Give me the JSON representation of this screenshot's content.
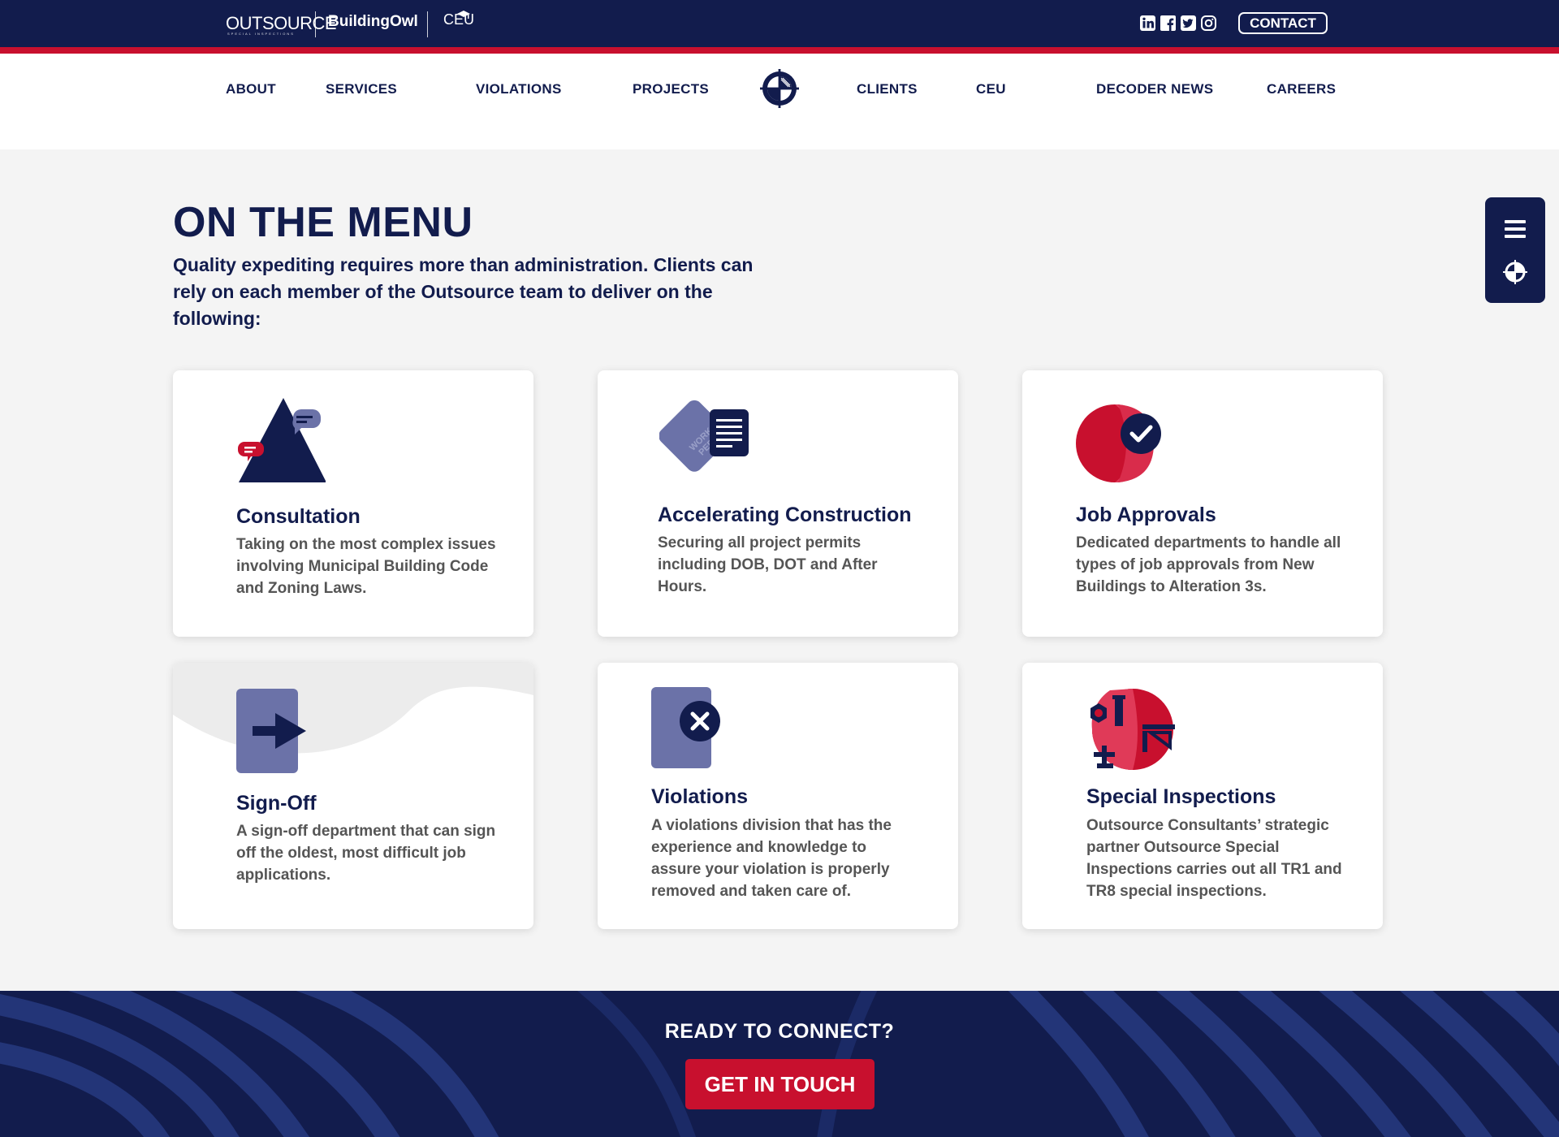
{
  "header": {
    "brand_outsource": "OUTSOURCE",
    "brand_outsource_sub": "SPECIAL INSPECTIONS",
    "brand_buildingowl": "BuildingOwl",
    "brand_ceu": "CEU",
    "social_icons": [
      "linkedin-icon",
      "facebook-icon",
      "twitter-icon",
      "instagram-icon"
    ],
    "contact_label": "CONTACT"
  },
  "nav": {
    "items": [
      "ABOUT",
      "SERVICES",
      "VIOLATIONS",
      "PROJECTS",
      "CLIENTS",
      "CEU",
      "DECODER NEWS",
      "CAREERS"
    ]
  },
  "side_widget": {
    "icons": [
      "menu-icon",
      "crosshair-icon"
    ]
  },
  "main": {
    "title": "ON THE MENU",
    "intro": "Quality expediting requires more than administration. Clients can rely on each member of the Outsource team to deliver on the following:",
    "cards": [
      {
        "title": "Consultation",
        "description": "Taking on the most complex issues involving Municipal Building Code and Zoning Laws.",
        "icon": "consultation-icon"
      },
      {
        "title": "Accelerating Construction",
        "description": "Securing all project permits including DOB, DOT and After Hours.",
        "icon": "work-permit-icon",
        "icon_text": "WORK PERMIT"
      },
      {
        "title": "Job Approvals",
        "description": "Dedicated departments to handle all types of job approvals from New Buildings to Alteration 3s.",
        "icon": "job-approval-icon"
      },
      {
        "title": "Sign-Off",
        "description": "A sign-off department that can sign off the oldest, most difficult job applications.",
        "icon": "sign-off-icon"
      },
      {
        "title": "Violations",
        "description": "A violations division that has the experience and knowledge to assure your violation is properly removed and taken care of.",
        "icon": "violations-icon"
      },
      {
        "title": "Special Inspections",
        "description": "Outsource Consultants’ strategic partner Outsource Special Inspections carries out all TR1 and TR8 special inspections.",
        "icon": "special-inspections-icon"
      }
    ]
  },
  "cta": {
    "heading": "READY TO CONNECT?",
    "button_label": "GET IN TOUCH"
  },
  "colors": {
    "navy": "#121c4d",
    "red": "#c8102e",
    "slate": "#6b72a8",
    "text_gray": "#555555",
    "page_bg": "#f4f4f4"
  }
}
